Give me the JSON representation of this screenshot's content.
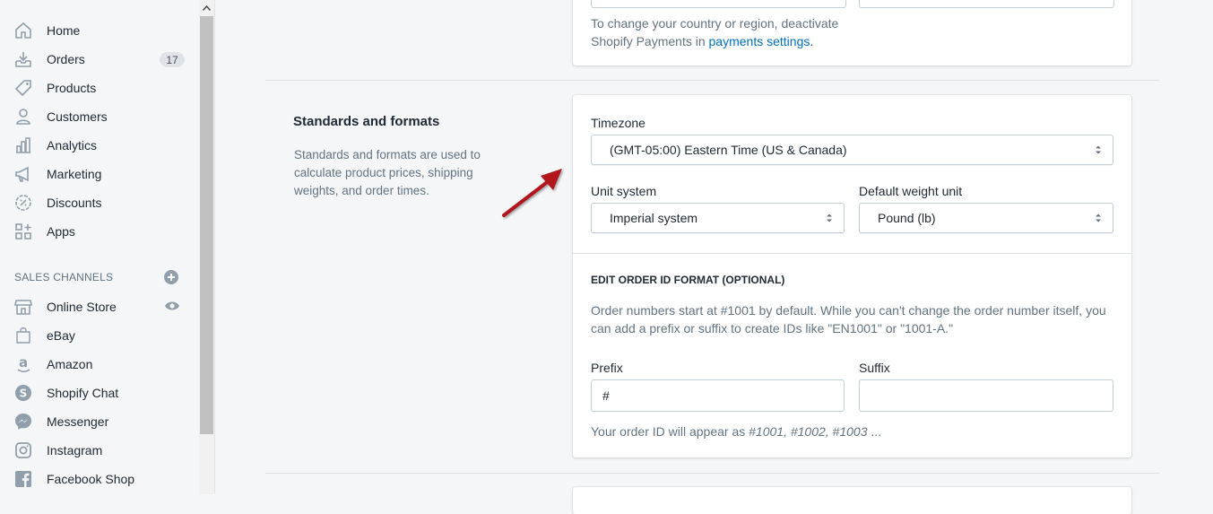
{
  "colors": {
    "accent": "#006fbb",
    "arrow": "#b0161b",
    "sidebar_bg": "#f4f6f8"
  },
  "sidebar": {
    "items": [
      {
        "label": "Home",
        "icon": "home-icon"
      },
      {
        "label": "Orders",
        "icon": "orders-icon",
        "badge": "17"
      },
      {
        "label": "Products",
        "icon": "tag-icon"
      },
      {
        "label": "Customers",
        "icon": "person-icon"
      },
      {
        "label": "Analytics",
        "icon": "bar-chart-icon"
      },
      {
        "label": "Marketing",
        "icon": "megaphone-icon"
      },
      {
        "label": "Discounts",
        "icon": "discount-icon"
      },
      {
        "label": "Apps",
        "icon": "apps-icon"
      }
    ],
    "channels_heading": "SALES CHANNELS",
    "channels": [
      {
        "label": "Online Store",
        "icon": "store-icon"
      },
      {
        "label": "eBay",
        "icon": "bag-icon"
      },
      {
        "label": "Amazon",
        "icon": "amazon-icon"
      },
      {
        "label": "Shopify Chat",
        "icon": "shopify-chat-icon"
      },
      {
        "label": "Messenger",
        "icon": "messenger-icon"
      },
      {
        "label": "Instagram",
        "icon": "instagram-icon"
      },
      {
        "label": "Facebook Shop",
        "icon": "facebook-icon"
      }
    ]
  },
  "top_card": {
    "note_line1": "To change your country or region, deactivate",
    "note_line2": "Shopify Payments in ",
    "note_link": "payments settings."
  },
  "standards": {
    "title": "Standards and formats",
    "desc_line1": "Standards and formats are used to",
    "desc_line2": "calculate product prices, shipping",
    "desc_line3": "weights, and order times.",
    "timezone_label": "Timezone",
    "timezone_value": "(GMT-05:00) Eastern Time (US & Canada)",
    "unit_label": "Unit system",
    "unit_value": "Imperial system",
    "weight_label": "Default weight unit",
    "weight_value": "Pound (lb)"
  },
  "order_id": {
    "heading": "EDIT ORDER ID FORMAT (OPTIONAL)",
    "desc_line1": "Order numbers start at #1001 by default. While you can't change the order number itself, you",
    "desc_line2": "can add a prefix or suffix to create IDs like \"EN1001\" or \"1001-A.\"",
    "prefix_label": "Prefix",
    "prefix_value": "#",
    "suffix_label": "Suffix",
    "suffix_value": "",
    "preview_prefix": "Your order ID will appear as ",
    "preview_ids": "#1001, #1002, #1003",
    "preview_suffix": " ..."
  }
}
